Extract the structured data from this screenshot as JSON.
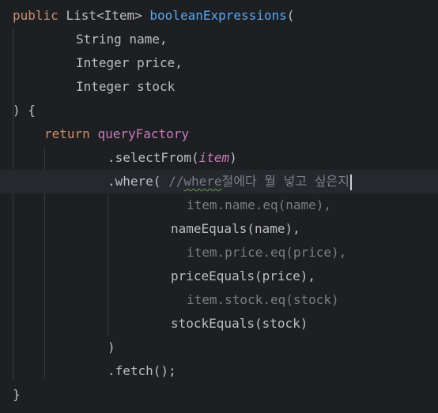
{
  "code": {
    "l1": {
      "kw_public": "public",
      "type": "List<Item>",
      "method": "booleanExpressions",
      "paren": "("
    },
    "l2": {
      "text": "String name,"
    },
    "l3": {
      "text": "Integer price,"
    },
    "l4": {
      "text": "Integer stock"
    },
    "l5": {
      "text": ") {"
    },
    "l6": {
      "kw_return": "return",
      "field": "queryFactory"
    },
    "l7": {
      "call": ".selectFrom(",
      "arg": "item",
      "close": ")"
    },
    "l8": {
      "call": ".where( ",
      "comment_prefix": "//",
      "comment_typo": "where",
      "comment_rest": "절에다 뭘 넣고 싶은지"
    },
    "l9": {
      "text": "item.name.eq(name),"
    },
    "l10": {
      "text": "nameEquals(name),"
    },
    "l11": {
      "text": "item.price.eq(price),"
    },
    "l12": {
      "text": "priceEquals(price),"
    },
    "l13": {
      "text": "item.stock.eq(stock)"
    },
    "l14": {
      "text": "stockEquals(stock)"
    },
    "l15": {
      "text": ")"
    },
    "l16": {
      "text": ".fetch();"
    },
    "l17": {
      "text": "}"
    }
  },
  "colors": {
    "background": "#1e1f22",
    "keyword": "#cf8e6d",
    "method": "#56a8f5",
    "field": "#c77dbb",
    "comment": "#7a7e85",
    "text": "#bcbec4"
  }
}
